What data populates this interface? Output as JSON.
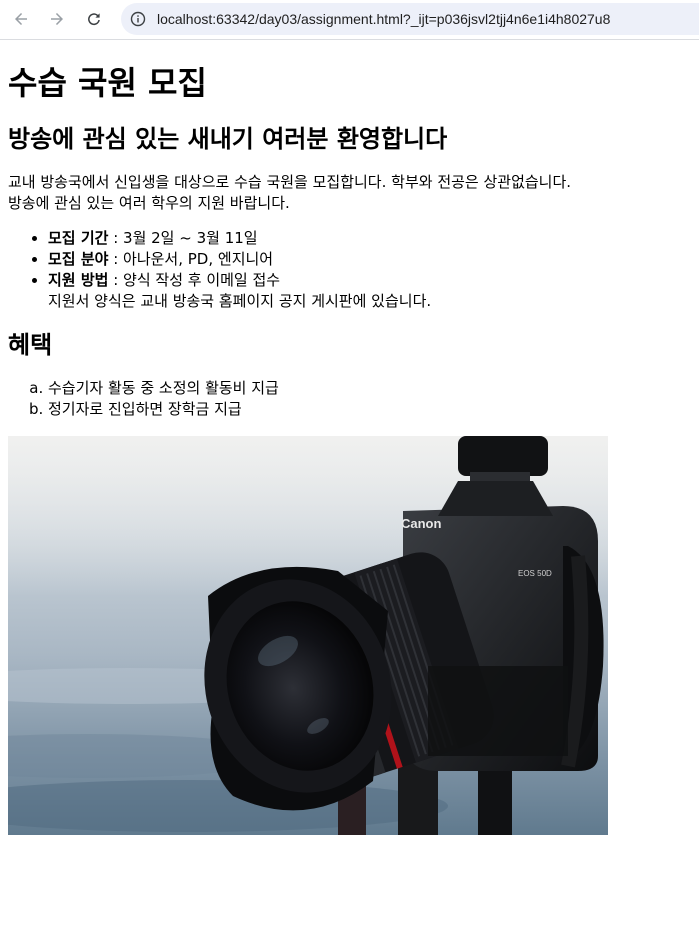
{
  "browser": {
    "url": "localhost:63342/day03/assignment.html?_ijt=p036jsvl2tjj4n6e1i4h8027u8"
  },
  "page": {
    "title": "수습 국원 모집",
    "subtitle": "방송에 관심 있는 새내기 여러분 환영합니다",
    "intro_line1": "교내 방송국에서 신입생을 대상으로 수습 국원을 모집합니다. 학부와 전공은 상관없습니다.",
    "intro_line2": "방송에 관심 있는 여러 학우의 지원 바랍니다.",
    "details": [
      {
        "label": "모집 기간",
        "value": " : 3월 2일 ~ 3월 11일"
      },
      {
        "label": "모집 분야",
        "value": " : 아나운서, PD, 엔지니어"
      },
      {
        "label": "지원 방법",
        "value": " : 양식 작성 후 이메일 접수",
        "note": "지원서 양식은 교내 방송국 홈페이지 공지 게시판에 있습니다."
      }
    ],
    "benefits_heading": "혜택",
    "benefits": [
      "수습기자 활동 중 소정의 활동비 지급",
      "정기자로 진입하면 장학금 지급"
    ],
    "camera_brand": "Canon",
    "camera_model": "EOS 50D"
  }
}
